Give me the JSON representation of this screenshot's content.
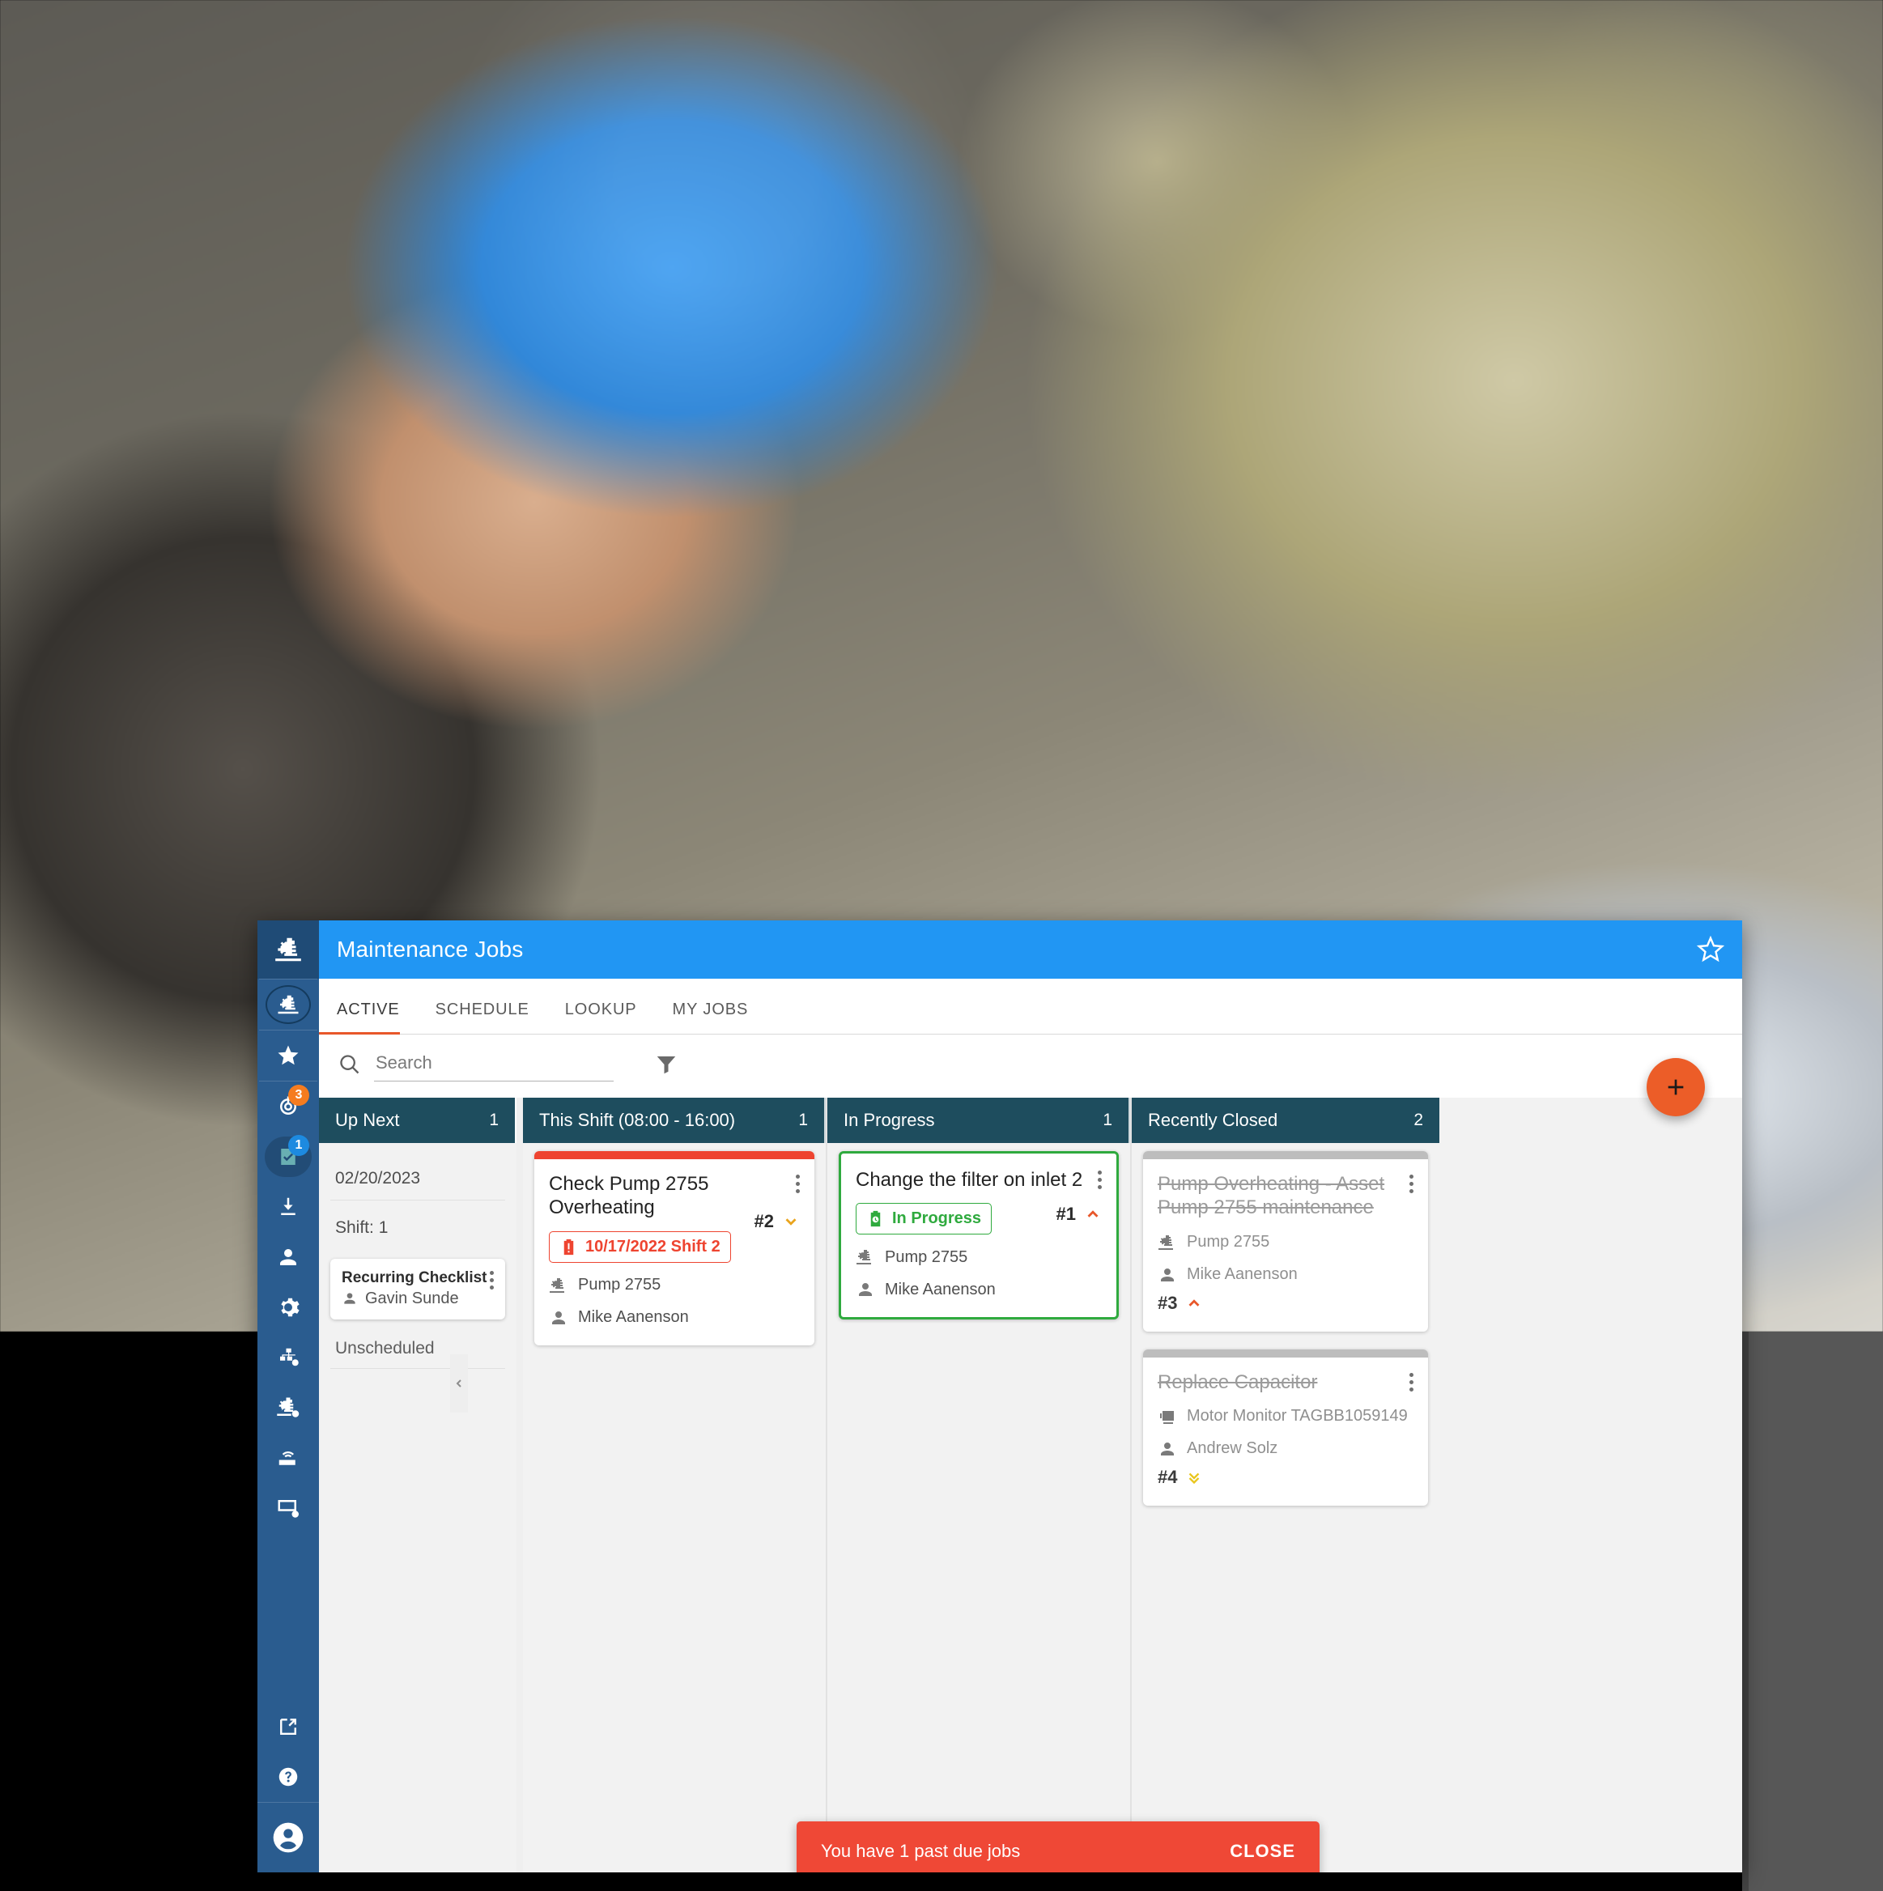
{
  "window": {
    "title": "Maintenance Jobs",
    "favorite_icon": "star-outline-icon",
    "app_logo_icon": "pump-machine-icon"
  },
  "tabs": [
    {
      "label": "ACTIVE",
      "active": true
    },
    {
      "label": "SCHEDULE",
      "active": false
    },
    {
      "label": "LOOKUP",
      "active": false
    },
    {
      "label": "MY JOBS",
      "active": false
    }
  ],
  "search": {
    "value": "",
    "placeholder": "Search",
    "icon": "search-icon",
    "filter_icon": "filter-icon"
  },
  "fab": {
    "label": "+",
    "icon": "plus-icon",
    "color": "#ec5d28"
  },
  "sidebar": {
    "items": [
      {
        "name": "pump-machine",
        "icon": "pump-machine-icon",
        "badge": ""
      },
      {
        "name": "favorites",
        "icon": "star-icon",
        "badge": ""
      },
      {
        "name": "alerts",
        "icon": "target-alert-icon",
        "badge": "3"
      },
      {
        "name": "tasks",
        "icon": "checklist-icon",
        "badge": "1"
      },
      {
        "name": "downloads",
        "icon": "download-icon",
        "badge": ""
      },
      {
        "name": "people",
        "icon": "person-icon",
        "badge": ""
      },
      {
        "name": "settings",
        "icon": "gear-icon",
        "badge": ""
      },
      {
        "name": "hierarchy-config",
        "icon": "sitemap-gear-icon",
        "badge": ""
      },
      {
        "name": "asset-config",
        "icon": "pump-gear-icon",
        "badge": ""
      },
      {
        "name": "device-network",
        "icon": "router-wifi-icon",
        "badge": ""
      },
      {
        "name": "display-config",
        "icon": "monitor-gear-icon",
        "badge": ""
      }
    ],
    "bottom_items": [
      {
        "name": "open-external",
        "icon": "external-link-icon"
      },
      {
        "name": "help",
        "icon": "question-circle-icon"
      },
      {
        "name": "account",
        "icon": "account-avatar-icon"
      }
    ]
  },
  "board": {
    "collapse_icon": "chevron-left-icon",
    "columns": [
      {
        "title": "Up Next",
        "count": "1"
      },
      {
        "title": "This Shift (08:00 - 16:00)",
        "count": "1"
      },
      {
        "title": "In Progress",
        "count": "1"
      },
      {
        "title": "Recently Closed",
        "count": "2"
      }
    ]
  },
  "up_next": {
    "date_label": "02/20/2023",
    "shift_label": "Shift: 1",
    "unscheduled_label": "Unscheduled",
    "card": {
      "title": "Recurring Checklist",
      "person": "Gavin Sunde"
    }
  },
  "this_shift": {
    "card": {
      "title": "Check Pump 2755 Overheating",
      "chip": "10/17/2022 Shift 2",
      "chip_icon": "clipboard-alert-icon",
      "rank": "#2",
      "rank_icon": "chevron-down-icon",
      "rank_color": "#e9a41d",
      "asset": "Pump 2755",
      "person": "Mike Aanenson",
      "stripe_color": "#ee4430"
    }
  },
  "in_progress": {
    "card": {
      "title": "Change the filter on inlet 2",
      "chip": "In Progress",
      "chip_icon": "clipboard-clock-icon",
      "rank": "#1",
      "rank_icon": "chevron-up-icon",
      "rank_color": "#e8572a",
      "asset": "Pump 2755",
      "person": "Mike Aanenson",
      "border_color": "#2faa3e"
    }
  },
  "recently_closed": {
    "cards": [
      {
        "title": "Pump Overheating - Asset Pump 2755 maintenance",
        "asset": "Pump 2755",
        "asset_icon": "pump-icon",
        "person": "Mike Aanenson",
        "rank": "#3",
        "rank_icon": "chevron-up-icon",
        "rank_color": "#e8572a"
      },
      {
        "title": "Replace Capacitor",
        "asset": "Motor Monitor TAGBB1059149",
        "asset_icon": "monitor-device-icon",
        "person": "Andrew Solz",
        "rank": "#4",
        "rank_icon": "double-chevron-down-icon",
        "rank_color": "#e9c61d"
      }
    ]
  },
  "snackbar": {
    "message": "You have 1 past due jobs",
    "close_label": "CLOSE",
    "color": "#ef4836"
  }
}
